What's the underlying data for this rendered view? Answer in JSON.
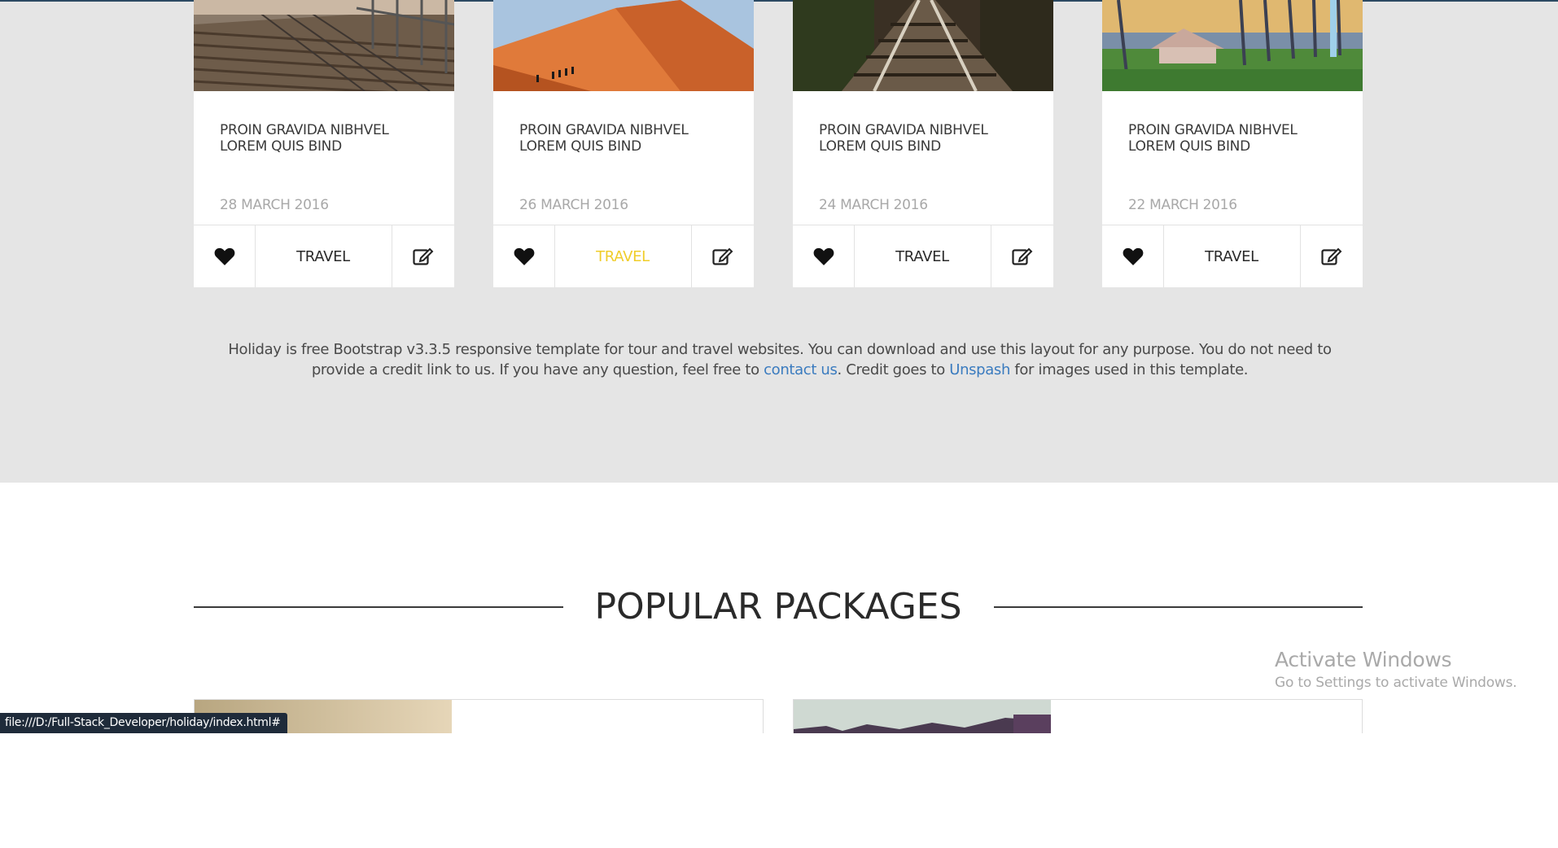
{
  "posts": [
    {
      "title": "PROIN GRAVIDA NIBHVEL LOREM QUIS BIND",
      "date": "28 MARCH 2016",
      "category": "TRAVEL",
      "category_active": false,
      "image": "boardwalk-pier"
    },
    {
      "title": "PROIN GRAVIDA NIBHVEL LOREM QUIS BIND",
      "date": "26 MARCH 2016",
      "category": "TRAVEL",
      "category_active": true,
      "image": "desert-dune"
    },
    {
      "title": "PROIN GRAVIDA NIBHVEL LOREM QUIS BIND",
      "date": "24 MARCH 2016",
      "category": "TRAVEL",
      "category_active": false,
      "image": "railway-tracks"
    },
    {
      "title": "PROIN GRAVIDA NIBHVEL LOREM QUIS BIND",
      "date": "22 MARCH 2016",
      "category": "TRAVEL",
      "category_active": false,
      "image": "tree-lined-road"
    }
  ],
  "about": {
    "text_1": "Holiday is free Bootstrap v3.3.5 responsive template for tour and travel websites. You can download and use this layout for any purpose. You do not need to provide a credit link to us. If you have any question, feel free to ",
    "contact_link": "contact us",
    "text_2": ". Credit goes to ",
    "unsplash_link": "Unspash",
    "text_3": " for images used in this template."
  },
  "packages": {
    "title": "POPULAR PACKAGES"
  },
  "windows_notice": {
    "title": "Activate Windows",
    "subtitle": "Go to Settings to activate Windows."
  },
  "status_bar": {
    "url": "file:///D:/Full-Stack_Developer/holiday/index.html#"
  },
  "colors": {
    "section_bg": "#e5e5e5",
    "active_category": "#f0cd2a",
    "link": "#3a7bbf"
  },
  "icons": {
    "like": "heart-icon",
    "edit": "edit-icon"
  }
}
